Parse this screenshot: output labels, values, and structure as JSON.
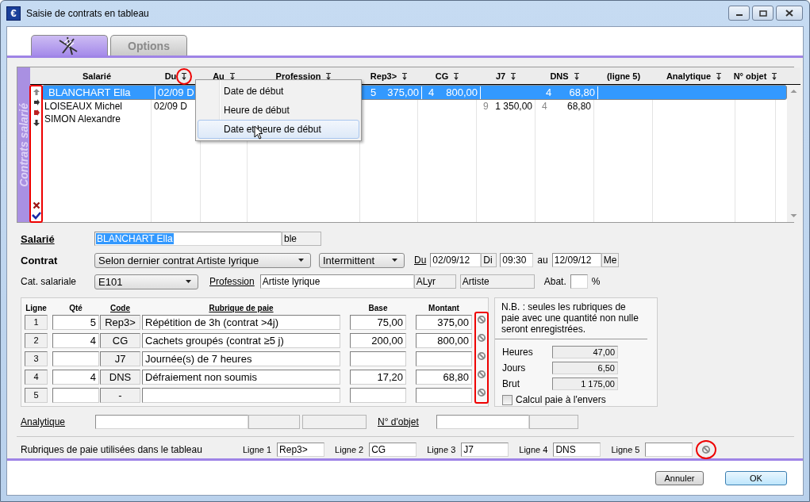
{
  "window": {
    "icon": "€",
    "title": "Saisie de contrats en tableau"
  },
  "tabs": [
    {
      "kind": "icon",
      "selected": true
    },
    {
      "kind": "text",
      "label": "Options",
      "selected": false
    }
  ],
  "grid": {
    "side_label": "Contrats salarié",
    "actions_annotated": true,
    "columns": [
      {
        "label": "Salarié",
        "sort": false,
        "annotated": false
      },
      {
        "label": "Du",
        "sort": true,
        "annotated": true
      },
      {
        "label": "Au",
        "sort": true,
        "annotated": false
      },
      {
        "label": "Profession",
        "sort": true,
        "annotated": false
      },
      {
        "label": "Rep3>",
        "sort": true,
        "annotated": false
      },
      {
        "label": "CG",
        "sort": true,
        "annotated": false
      },
      {
        "label": "J7",
        "sort": true,
        "annotated": false
      },
      {
        "label": "DNS",
        "sort": true,
        "annotated": false
      },
      {
        "label": "(ligne 5)",
        "sort": false,
        "annotated": false
      },
      {
        "label": "Analytique",
        "sort": true,
        "annotated": false
      },
      {
        "label": "N° objet",
        "sort": true,
        "annotated": false
      }
    ],
    "rows": [
      {
        "selected": true,
        "salarie": "BLANCHART Ella",
        "du": "02/09 D",
        "pay": {
          "rep3": {
            "qty": "5",
            "amount": "375,00"
          },
          "cg": {
            "qty": "4",
            "amount": "800,00"
          },
          "dns": {
            "qty": "4",
            "amount": "68,80"
          }
        }
      },
      {
        "selected": false,
        "salarie": "LOISEAUX Michel",
        "du": "02/09 D",
        "pay": {
          "j7": {
            "qty": "9",
            "amount": "1 350,00"
          },
          "dns": {
            "qty": "4",
            "amount": "68,80"
          }
        }
      },
      {
        "selected": false,
        "salarie": "SIMON Alexandre"
      }
    ],
    "menu": {
      "items": [
        {
          "label": "Date de début",
          "highlighted": false
        },
        {
          "label": "Heure de début",
          "highlighted": false
        },
        {
          "label": "Date et heure de début",
          "highlighted": true
        }
      ]
    }
  },
  "salarie": {
    "label": "Salarié",
    "value": "BLANCHART Ella",
    "code": "ble"
  },
  "contrat": {
    "label": "Contrat",
    "value": "Selon dernier contrat Artiste lyrique",
    "type": "Intermittent",
    "du_label": "Du",
    "date_start": "02/09/12",
    "day_start": "Di",
    "time_start": "09:30",
    "au_label": "au",
    "date_end": "12/09/12",
    "day_end": "Me"
  },
  "categorie": {
    "label": "Cat. salariale",
    "value": "E101",
    "profession_label": "Profession",
    "profession": "Artiste lyrique",
    "profession_code": "ALyr",
    "profession_group": "Artiste",
    "abat_label": "Abat.",
    "abat_unit": "%"
  },
  "pay_lines": {
    "clear_annotated": true,
    "columns": [
      "Ligne",
      "Qté",
      "Code",
      "Rubrique de paie",
      "Base",
      "Montant"
    ],
    "rows": [
      {
        "ligne": "1",
        "qte": "5",
        "code": "Rep3>",
        "rubrique": "Répétition de 3h (contrat >4j)",
        "base": "75,00",
        "montant": "375,00"
      },
      {
        "ligne": "2",
        "qte": "4",
        "code": "CG",
        "rubrique": "Cachets groupés (contrat ≥5 j)",
        "base": "200,00",
        "montant": "800,00"
      },
      {
        "ligne": "3",
        "code": "J7",
        "rubrique": "Journée(s) de 7 heures"
      },
      {
        "ligne": "4",
        "qte": "4",
        "code": "DNS",
        "rubrique": "Défraiement non soumis",
        "base": "17,20",
        "montant": "68,80"
      },
      {
        "ligne": "5",
        "code": "-"
      }
    ]
  },
  "notes": {
    "text": "N.B. : seules les rubriques de paie avec une quantité non nulle seront enregistrées.",
    "totals": [
      {
        "label": "Heures",
        "value": "47,00"
      },
      {
        "label": "Jours",
        "value": "6,50"
      },
      {
        "label": "Brut",
        "value": "1 175,00"
      }
    ],
    "reverse": {
      "label": "Calcul paie à l'envers",
      "checked": false
    }
  },
  "analytique": {
    "label": "Analytique",
    "objet_label": "N° d'objet"
  },
  "rubriques_used": {
    "label": "Rubriques de paie utilisées dans le tableau",
    "clear_annotated": true,
    "lines": [
      {
        "label": "Ligne 1",
        "value": "Rep3>"
      },
      {
        "label": "Ligne 2",
        "value": "CG"
      },
      {
        "label": "Ligne 3",
        "value": "J7"
      },
      {
        "label": "Ligne 4",
        "value": "DNS"
      },
      {
        "label": "Ligne 5"
      }
    ]
  },
  "buttons": [
    {
      "label": "Annuler",
      "default": false
    },
    {
      "label": "OK",
      "default": true
    }
  ]
}
